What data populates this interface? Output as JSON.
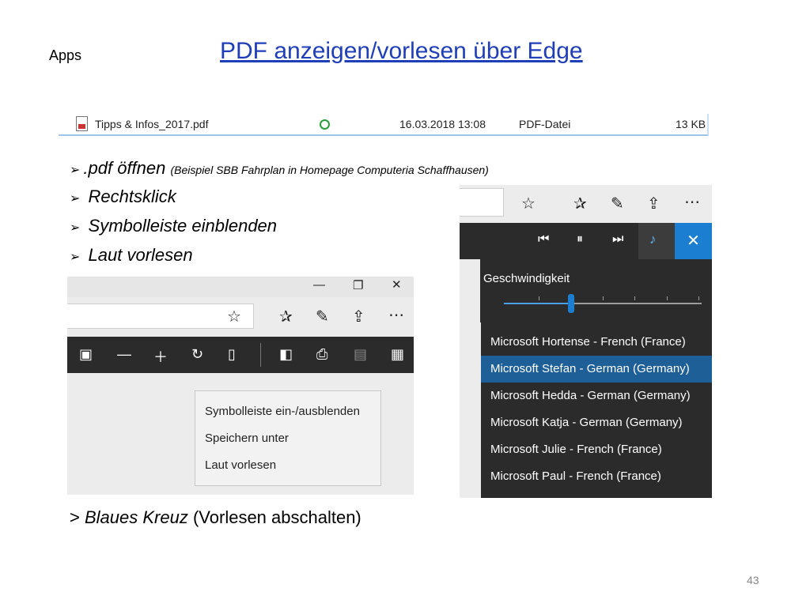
{
  "slide": {
    "label": "Apps",
    "title": "PDF anzeigen/vorlesen über Edge",
    "page_number": "43"
  },
  "file_row": {
    "name": "Tipps & Infos_2017.pdf",
    "date": "16.03.2018 13:08",
    "type": "PDF-Datei",
    "size": "13 KB"
  },
  "bullets": {
    "b1_main": ".pdf öffnen",
    "b1_note": "(Beispiel SBB Fahrplan in Homepage Computeria Schaffhausen)",
    "b2": "Rechtsklick",
    "b3": "Symbolleiste einblenden",
    "b4": "Laut vorlesen"
  },
  "context_menu": {
    "items": [
      "Symbolleiste ein-/ausblenden",
      "Speichern unter",
      "Laut vorlesen"
    ]
  },
  "read_aloud": {
    "speed_label": "Geschwindigkeit",
    "speed_value": 0.34,
    "voices": [
      "Microsoft Hortense - French (France)",
      "Microsoft Stefan - German (Germany)",
      "Microsoft Hedda - German (Germany)",
      "Microsoft Katja - German (Germany)",
      "Microsoft Julie - French (France)",
      "Microsoft Paul - French (France)"
    ],
    "selected_voice": "Microsoft Stefan - German (Germany)"
  },
  "footer": {
    "prefix": ">",
    "em": "Blaues Kreuz",
    "rest": "(Vorlesen abschalten)"
  },
  "colors": {
    "title_link": "#1f3eb8",
    "toolbar_dark": "#2b2b2b",
    "accent_blue": "#1b7ed0",
    "selected_voice_bg": "#1d5f96"
  },
  "icons": [
    "pdf-file-icon",
    "sync-ok-icon",
    "star-icon",
    "favorites-icon",
    "pen-icon",
    "share-icon",
    "more-icon",
    "fit-page-icon",
    "zoom-out-icon",
    "zoom-in-icon",
    "rotate-icon",
    "page-layout-icon",
    "read-aloud-icon",
    "print-icon",
    "save-icon",
    "save-as-icon",
    "previous-icon",
    "pause-icon",
    "next-icon",
    "voice-icon",
    "close-icon"
  ]
}
